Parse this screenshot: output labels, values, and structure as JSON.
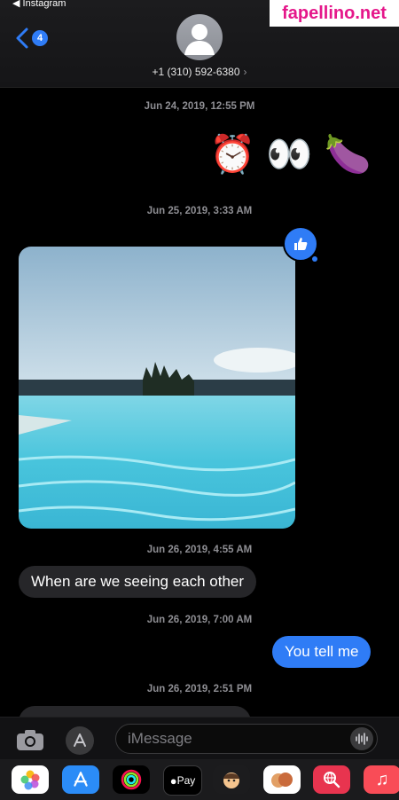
{
  "status": {
    "back_app": "◀ Instagram"
  },
  "header": {
    "back_badge": "4",
    "contact": "+1 (310) 592-6380",
    "contact_chevron": "›"
  },
  "watermark": "fapellino.net",
  "timestamps": [
    "Jun 24, 2019, 12:55 PM",
    "Jun 25, 2019, 3:33 AM",
    "Jun 26, 2019, 4:55 AM",
    "Jun 26, 2019, 7:00 AM",
    "Jun 26, 2019, 2:51 PM"
  ],
  "emojis": [
    "⏰",
    "👀",
    "🍆"
  ],
  "messages": {
    "incoming_1": "When are we seeing each other",
    "outgoing_1": "You tell me"
  },
  "tapback_icon": "thumbs-up-icon",
  "input": {
    "placeholder": "iMessage"
  },
  "tray": {
    "apple_pay": "Pay"
  },
  "colors": {
    "accent": "#2f7cf6",
    "incoming_bubble": "#262629",
    "background": "#000000"
  }
}
